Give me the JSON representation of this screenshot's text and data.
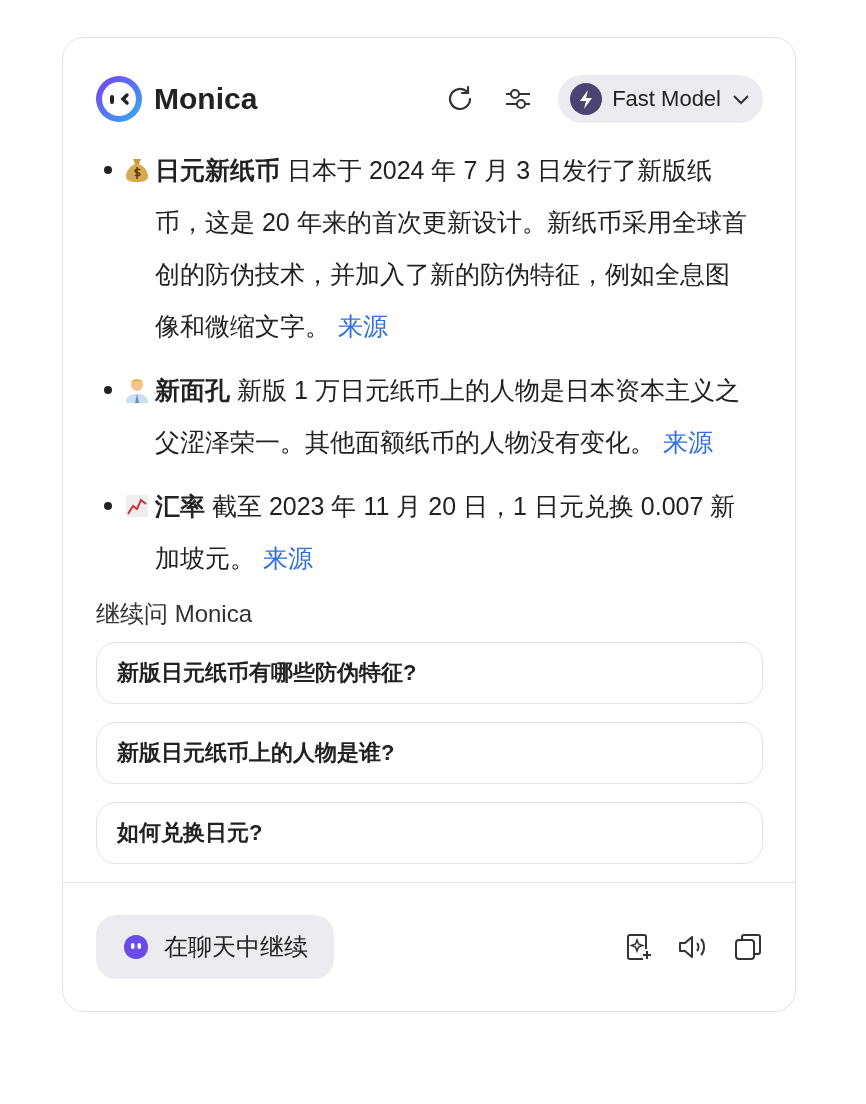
{
  "header": {
    "title": "Monica",
    "model": "Fast Model"
  },
  "answer": [
    {
      "text": "**日元新纸币** 日本于 2024 年 7 月 3 日发行了新版纸币，这是 20 年来的首次更新设计。新纸币采用全球首创的防伪技术，并加入了新的防伪特征，例如全息图像和微缩文字。",
      "link": "来源"
    },
    {
      "text": "**新面孔** 新版 1 万日元纸币上的人物是日本资本主义之父涩泽荣一。其他面额纸币的人物没有变化。",
      "link": "来源"
    },
    {
      "text": "**汇率** 截至 2023 年 11 月 20 日，1 日元兑换 0.007 新加坡元。",
      "link": "来源"
    }
  ],
  "followups": {
    "heading": "继续问 Monica",
    "questions": [
      "新版日元纸币有哪些防伪特征?",
      "新版日元纸币上的人物是谁?",
      "如何兑换日元?"
    ]
  },
  "footer": {
    "button": "在聊天中继续"
  }
}
